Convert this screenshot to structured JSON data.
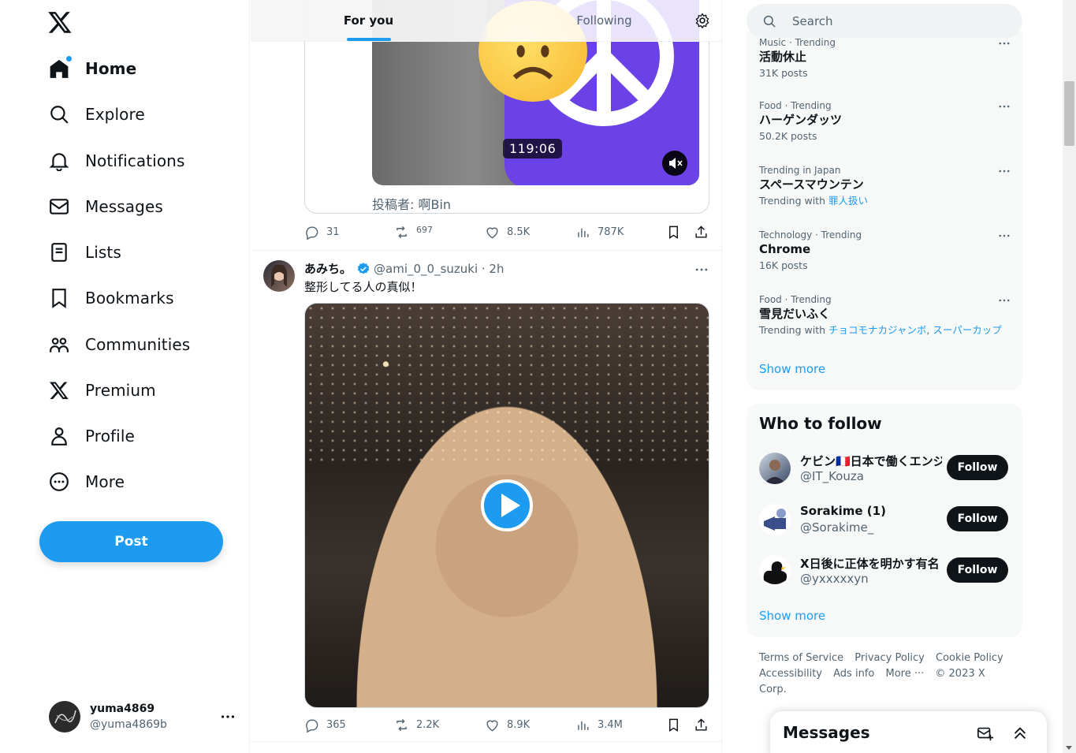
{
  "nav": {
    "items": [
      {
        "label": "Home"
      },
      {
        "label": "Explore"
      },
      {
        "label": "Notifications"
      },
      {
        "label": "Messages"
      },
      {
        "label": "Lists"
      },
      {
        "label": "Bookmarks"
      },
      {
        "label": "Communities"
      },
      {
        "label": "Premium"
      },
      {
        "label": "Profile"
      },
      {
        "label": "More"
      }
    ],
    "post_label": "Post",
    "account": {
      "name": "yuma4869",
      "handle": "@yuma4869b"
    }
  },
  "tabs": {
    "for_you": "For you",
    "following": "Following"
  },
  "tweet1": {
    "video_time": "119:06",
    "poster": "投稿者: 啊Bin",
    "replies": "31",
    "reposts": "697",
    "likes": "8.5K",
    "views": "787K"
  },
  "tweet2": {
    "name": "あみち。",
    "handle_time": "@ami_0_0_suzuki · 2h",
    "text": "整形してる人の真似！",
    "replies": "365",
    "reposts": "2.2K",
    "likes": "8.9K",
    "views": "3.4M"
  },
  "search": {
    "placeholder": "Search"
  },
  "trends": [
    {
      "meta": "Music · Trending",
      "title": "活動休止",
      "count": "31K posts"
    },
    {
      "meta": "Food · Trending",
      "title": "ハーゲンダッツ",
      "count": "50.2K posts"
    },
    {
      "meta": "Trending in Japan",
      "title": "スペースマウンテン",
      "count_prefix": "Trending with",
      "link1": "罪人扱い"
    },
    {
      "meta": "Technology · Trending",
      "title": "Chrome",
      "count": "16K posts"
    },
    {
      "meta": "Food · Trending",
      "title": "雪見だいふく",
      "count_prefix": "Trending with",
      "link1": "チョコモナカジャンボ",
      "link2": "スーパーカップ"
    }
  ],
  "trends_show_more": "Show more",
  "who_to_follow": {
    "title": "Who to follow",
    "users": [
      {
        "name": "ケビン🇫🇷日本で働くエンジ",
        "handle": "@IT_Kouza",
        "button": "Follow"
      },
      {
        "name": "Sorakime (1)",
        "handle": "@Sorakime_",
        "button": "Follow"
      },
      {
        "name": "X日後に正体を明かす有名",
        "handle": "@yxxxxxyn",
        "button": "Follow"
      }
    ],
    "show_more": "Show more"
  },
  "footer": {
    "links": [
      "Terms of Service",
      "Privacy Policy",
      "Cookie Policy",
      "Accessibility",
      "Ads info",
      "More ···",
      "© 2023 X Corp."
    ]
  },
  "messages_drawer": {
    "title": "Messages"
  },
  "colors": {
    "accent": "#1d9bf0",
    "text": "#0f1419",
    "muted": "#536471",
    "panel": "#f7f9f9"
  }
}
